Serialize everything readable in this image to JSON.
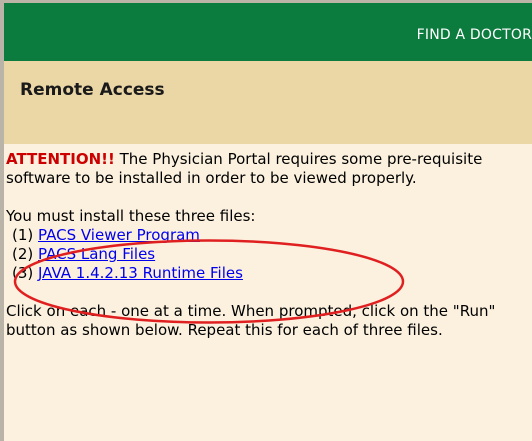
{
  "header": {
    "find_doctor": "FIND A DOCTOR"
  },
  "section": {
    "title": "Remote Access"
  },
  "notice": {
    "attention": "ATTENTION!!",
    "message": " The Physician Portal requires some pre-requisite software to be installed in order to be viewed properly."
  },
  "files": {
    "heading": "You must install these three files:",
    "items": [
      {
        "num": "(1) ",
        "label": "PACS Viewer Program"
      },
      {
        "num": "(2) ",
        "label": "PACS Lang Files"
      },
      {
        "num": "(3) ",
        "label": "JAVA 1.4.2.13 Runtime Files"
      }
    ]
  },
  "instructions": "Click on each - one at a time. When prompted, click on the \"Run\" button as shown below. Repeat this for each of three files.",
  "colors": {
    "header_green": "#0b7b3e",
    "section_tan": "#ebd6a6",
    "page_bg": "#fbf1de",
    "attention_red": "#cc0000",
    "link_blue": "#0000ee",
    "annotation_red": "#e02020"
  }
}
